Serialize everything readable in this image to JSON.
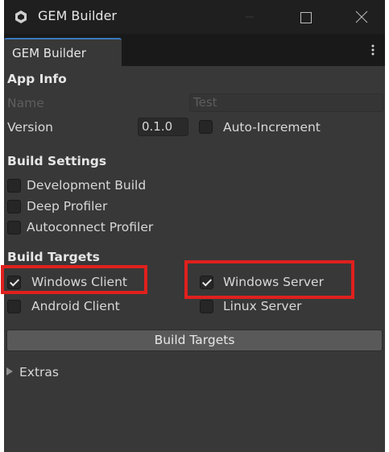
{
  "window": {
    "title": "GEM Builder",
    "icon": "unity-gear-icon"
  },
  "tab": {
    "label": "GEM Builder"
  },
  "app_info": {
    "header": "App Info",
    "name_label": "Name",
    "name_value": "Test",
    "version_label": "Version",
    "version_value": "0.1.0",
    "auto_increment_label": "Auto-Increment",
    "auto_increment_checked": false
  },
  "build_settings": {
    "header": "Build Settings",
    "items": [
      {
        "label": "Development Build",
        "checked": false
      },
      {
        "label": "Deep Profiler",
        "checked": false
      },
      {
        "label": "Autoconnect Profiler",
        "checked": false
      }
    ]
  },
  "build_targets": {
    "header": "Build Targets",
    "items": [
      {
        "label": "Windows Client",
        "checked": true,
        "highlighted": true
      },
      {
        "label": "Windows Server",
        "checked": true,
        "highlighted": true
      },
      {
        "label": "Android Client",
        "checked": false
      },
      {
        "label": "Linux Server",
        "checked": false
      }
    ],
    "button_label": "Build Targets"
  },
  "extras": {
    "label": "Extras",
    "expanded": false
  },
  "colors": {
    "highlight": "#e0201d",
    "tab_accent": "#3a79bb",
    "background": "#383838"
  }
}
